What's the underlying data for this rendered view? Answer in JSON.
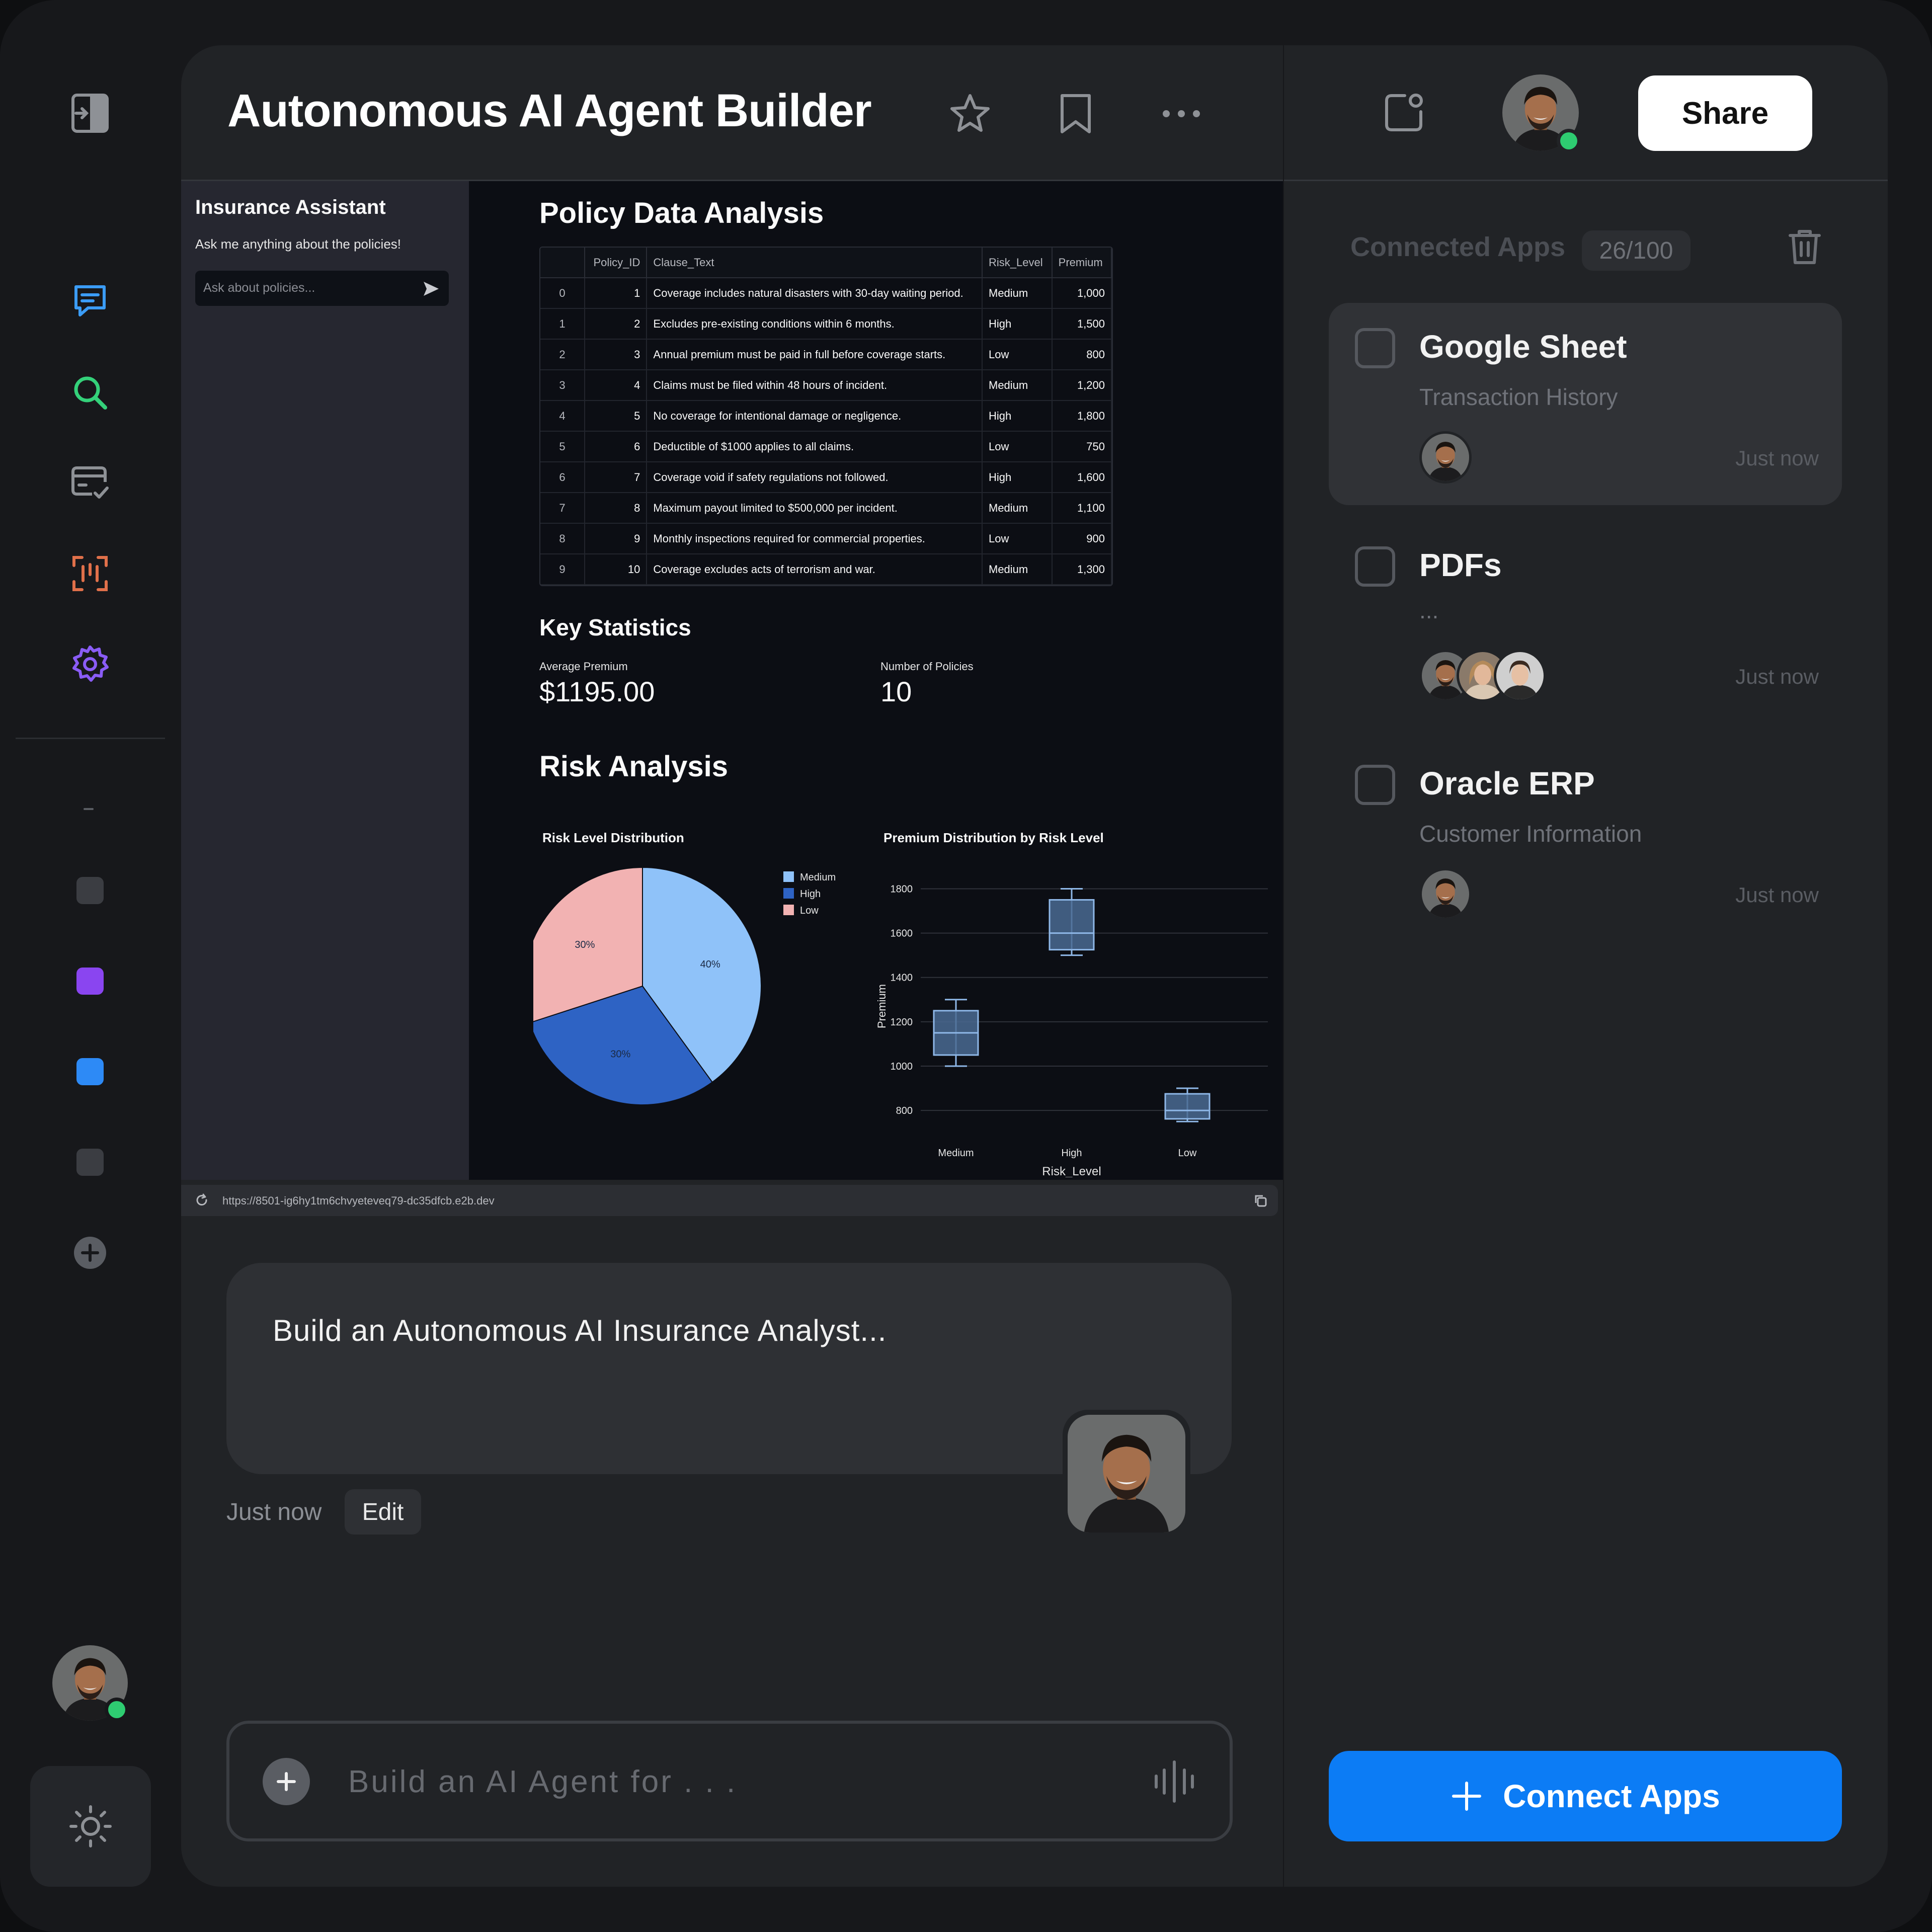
{
  "header": {
    "title": "Autonomous AI Agent Builder",
    "share_label": "Share"
  },
  "embedded_app": {
    "sidebar": {
      "title": "Insurance Assistant",
      "subtitle": "Ask me anything about the policies!",
      "input_placeholder": "Ask about policies..."
    },
    "sections": {
      "policy": "Policy Data Analysis",
      "stats": "Key Statistics",
      "risk": "Risk Analysis"
    },
    "table": {
      "columns": [
        "",
        "Policy_ID",
        "Clause_Text",
        "Risk_Level",
        "Premium"
      ],
      "rows": [
        [
          "0",
          "1",
          "Coverage includes natural disasters with 30-day waiting period.",
          "Medium",
          "1,000"
        ],
        [
          "1",
          "2",
          "Excludes pre-existing conditions within 6 months.",
          "High",
          "1,500"
        ],
        [
          "2",
          "3",
          "Annual premium must be paid in full before coverage starts.",
          "Low",
          "800"
        ],
        [
          "3",
          "4",
          "Claims must be filed within 48 hours of incident.",
          "Medium",
          "1,200"
        ],
        [
          "4",
          "5",
          "No coverage for intentional damage or negligence.",
          "High",
          "1,800"
        ],
        [
          "5",
          "6",
          "Deductible of $1000 applies to all claims.",
          "Low",
          "750"
        ],
        [
          "6",
          "7",
          "Coverage void if safety regulations not followed.",
          "High",
          "1,600"
        ],
        [
          "7",
          "8",
          "Maximum payout limited to $500,000 per incident.",
          "Medium",
          "1,100"
        ],
        [
          "8",
          "9",
          "Monthly inspections required for commercial properties.",
          "Low",
          "900"
        ],
        [
          "9",
          "10",
          "Coverage excludes acts of terrorism and war.",
          "Medium",
          "1,300"
        ]
      ]
    },
    "stats": [
      {
        "label": "Average Premium",
        "value": "$1195.00"
      },
      {
        "label": "Number of Policies",
        "value": "10"
      }
    ],
    "url": "https://8501-ig6hy1tm6chvyeteveq79-dc35dfcb.e2b.dev"
  },
  "chart_data": [
    {
      "type": "pie",
      "title": "Risk Level Distribution",
      "categories": [
        "Medium",
        "High",
        "Low"
      ],
      "values": [
        40,
        30,
        30
      ],
      "labels": [
        "40%",
        "30%",
        "30%"
      ],
      "colors": [
        "#8fc2f9",
        "#2e63c4",
        "#f2b2b2"
      ],
      "legend": "right"
    },
    {
      "type": "box",
      "title": "Premium Distribution by Risk Level",
      "xlabel": "Risk_Level",
      "ylabel": "Premium",
      "categories": [
        "Medium",
        "High",
        "Low"
      ],
      "yticks": [
        800,
        1000,
        1200,
        1400,
        1600,
        1800
      ],
      "ylim": [
        680,
        1860
      ],
      "boxes": [
        {
          "name": "Medium",
          "min": 1000,
          "q1": 1050,
          "median": 1150,
          "q3": 1250,
          "max": 1300
        },
        {
          "name": "High",
          "min": 1500,
          "q1": 1525,
          "median": 1600,
          "q3": 1750,
          "max": 1800
        },
        {
          "name": "Low",
          "min": 750,
          "q1": 762,
          "median": 800,
          "q3": 875,
          "max": 900
        }
      ],
      "grid": true
    }
  ],
  "chat": {
    "message": "Build an Autonomous AI Insurance Analyst...",
    "time": "Just now",
    "edit_label": "Edit",
    "input_placeholder": "Build an AI Agent for . . ."
  },
  "connected_apps": {
    "title": "Connected Apps",
    "count": "26/100",
    "items": [
      {
        "name": "Google Sheet",
        "subtitle": "Transaction History",
        "time": "Just now"
      },
      {
        "name": "PDFs",
        "subtitle": "...",
        "time": "Just now"
      },
      {
        "name": "Oracle ERP",
        "subtitle": "Customer Information",
        "time": "Just now"
      }
    ],
    "connect_label": "Connect Apps"
  },
  "colors": {
    "accent": "#0c7cf5",
    "online": "#2ecc71",
    "rail_chat": "#3b9cf6",
    "rail_search": "#34d17a",
    "rail_scan": "#e0704a",
    "rail_settings": "#8a5cf6"
  }
}
